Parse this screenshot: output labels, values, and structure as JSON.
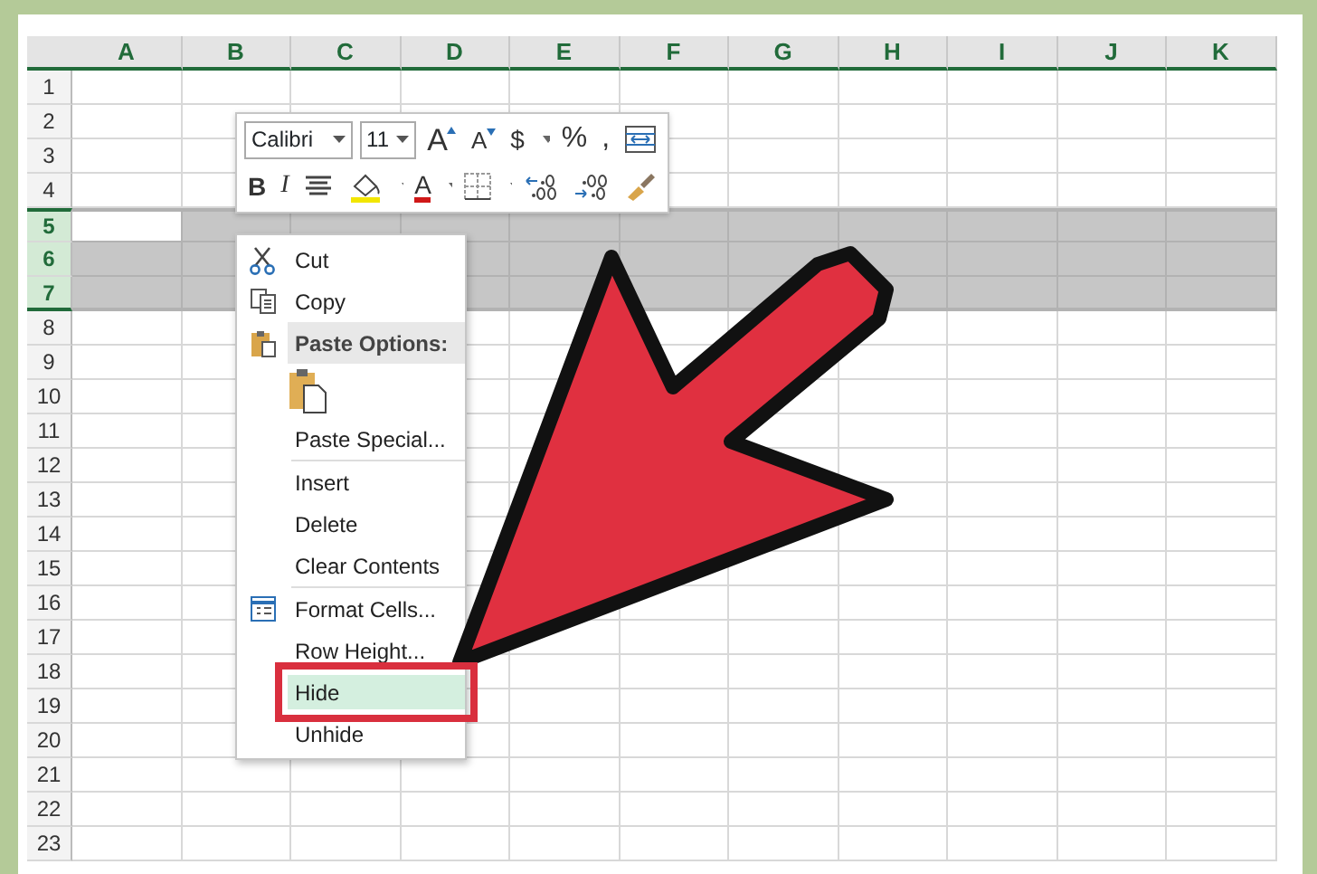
{
  "sheet": {
    "columns": [
      {
        "label": "A"
      },
      {
        "label": "B"
      },
      {
        "label": "C"
      },
      {
        "label": "D"
      },
      {
        "label": "E"
      },
      {
        "label": "F"
      },
      {
        "label": "G"
      },
      {
        "label": "H"
      },
      {
        "label": "I"
      },
      {
        "label": "J"
      },
      {
        "label": "K"
      }
    ],
    "rows": [
      {
        "label": "1",
        "selected": false
      },
      {
        "label": "2",
        "selected": false
      },
      {
        "label": "3",
        "selected": false
      },
      {
        "label": "4",
        "selected": false
      },
      {
        "label": "5",
        "selected": true
      },
      {
        "label": "6",
        "selected": true
      },
      {
        "label": "7",
        "selected": true
      },
      {
        "label": "8",
        "selected": false
      },
      {
        "label": "9",
        "selected": false
      },
      {
        "label": "10",
        "selected": false
      },
      {
        "label": "11",
        "selected": false
      },
      {
        "label": "12",
        "selected": false
      },
      {
        "label": "13",
        "selected": false
      },
      {
        "label": "14",
        "selected": false
      },
      {
        "label": "15",
        "selected": false
      },
      {
        "label": "16",
        "selected": false
      },
      {
        "label": "17",
        "selected": false
      },
      {
        "label": "18",
        "selected": false
      },
      {
        "label": "19",
        "selected": false
      },
      {
        "label": "20",
        "selected": false
      },
      {
        "label": "21",
        "selected": false
      },
      {
        "label": "22",
        "selected": false
      },
      {
        "label": "23",
        "selected": false
      }
    ]
  },
  "mini_toolbar": {
    "font": "Calibri",
    "size": "11",
    "row_1": [
      {
        "kind": "grow",
        "label": "A"
      },
      {
        "kind": "shrink",
        "label": "A"
      },
      {
        "kind": "text-caret",
        "label": "$"
      },
      {
        "kind": "text",
        "label": "%"
      },
      {
        "kind": "text",
        "label": ","
      },
      {
        "kind": "wrap"
      }
    ],
    "row_2": [
      {
        "kind": "bold",
        "label": "B"
      },
      {
        "kind": "italic",
        "label": "I"
      },
      {
        "kind": "align"
      },
      {
        "kind": "fill"
      },
      {
        "kind": "fontcolor",
        "label": "A"
      },
      {
        "kind": "border"
      },
      {
        "kind": "incdec"
      },
      {
        "kind": "decdec"
      },
      {
        "kind": "painter"
      }
    ]
  },
  "context_menu": [
    {
      "kind": "cut",
      "label": "Cut",
      "selected": false
    },
    {
      "kind": "copy",
      "label": "Copy",
      "selected": false
    },
    {
      "kind": "header",
      "label": "Paste Options:"
    },
    {
      "kind": "paste-button"
    },
    {
      "kind": "item",
      "label": "Paste Special...",
      "selected": false
    },
    {
      "kind": "separator"
    },
    {
      "kind": "item",
      "label": "Insert",
      "selected": false
    },
    {
      "kind": "item",
      "label": "Delete",
      "selected": false
    },
    {
      "kind": "item",
      "label": "Clear Contents",
      "selected": false
    },
    {
      "kind": "separator"
    },
    {
      "kind": "format",
      "label": "Format Cells...",
      "selected": false
    },
    {
      "kind": "item",
      "label": "Row Height...",
      "selected": false
    },
    {
      "kind": "item",
      "label": "Hide",
      "selected": true
    },
    {
      "kind": "item",
      "label": "Unhide",
      "selected": false
    }
  ]
}
